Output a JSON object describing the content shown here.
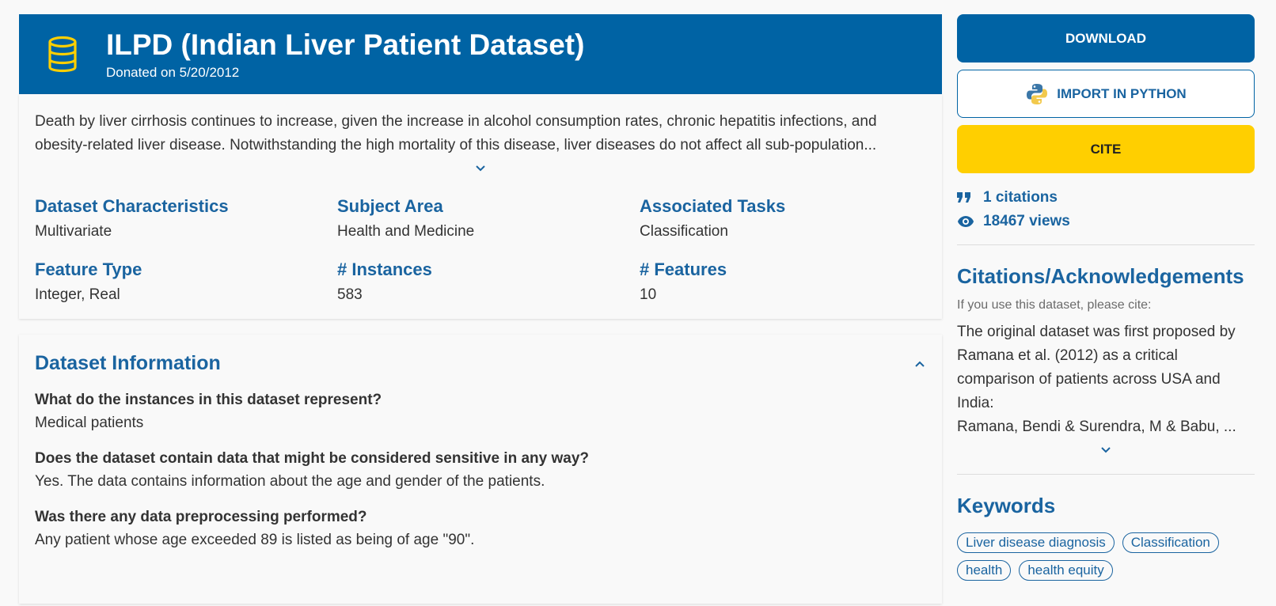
{
  "header": {
    "title": "ILPD (Indian Liver Patient Dataset)",
    "donated": "Donated on 5/20/2012",
    "icon": "database-icon"
  },
  "summary": {
    "description_line1": "Death by liver cirrhosis continues to increase, given the increase in alcohol consumption rates, chronic hepatitis infections, and",
    "description_line2": "obesity-related liver disease. Notwithstanding the high mortality of this disease, liver diseases do not affect all sub-population...",
    "characteristics": [
      {
        "label": "Dataset Characteristics",
        "value": "Multivariate"
      },
      {
        "label": "Subject Area",
        "value": "Health and Medicine"
      },
      {
        "label": "Associated Tasks",
        "value": "Classification"
      },
      {
        "label": "Feature Type",
        "value": "Integer, Real"
      },
      {
        "label": "# Instances",
        "value": "583"
      },
      {
        "label": "# Features",
        "value": "10"
      }
    ]
  },
  "info": {
    "title": "Dataset Information",
    "qa": [
      {
        "q": "What do the instances in this dataset represent?",
        "a": "Medical patients"
      },
      {
        "q": "Does the dataset contain data that might be considered sensitive in any way?",
        "a": "Yes. The data contains information about the age and gender of the patients."
      },
      {
        "q": "Was there any data preprocessing performed?",
        "a": "Any patient whose age exceeded 89 is listed as being of age \"90\"."
      }
    ]
  },
  "sidebar": {
    "download_label": "DOWNLOAD",
    "python_label": "IMPORT IN PYTHON",
    "cite_label": "CITE",
    "citations": "1 citations",
    "views": "18467 views",
    "citations_title": "Citations/Acknowledgements",
    "citations_sub": "If you use this dataset, please cite:",
    "cite_line1": "The original dataset was first proposed by",
    "cite_line2": "Ramana et al. (2012) as a critical",
    "cite_line3": "comparison of patients across USA and",
    "cite_line4": "India:",
    "cite_line5": "Ramana, Bendi & Surendra, M & Babu, ...",
    "keywords_title": "Keywords",
    "keywords": [
      "Liver disease diagnosis",
      "Classification",
      "health",
      "health equity"
    ]
  },
  "colors": {
    "primary": "#0063a4",
    "link": "#1a64a0",
    "cite": "#ffcf00",
    "db_icon": "#ffcf00"
  }
}
